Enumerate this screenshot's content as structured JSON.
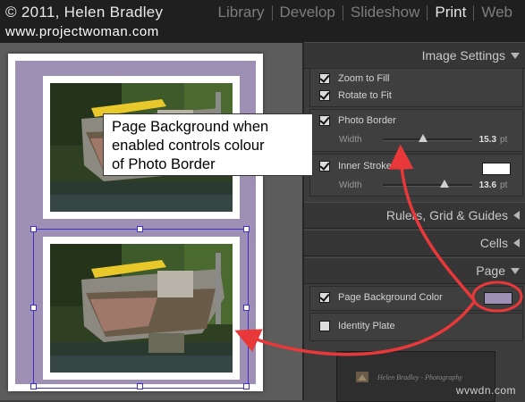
{
  "header": {
    "copyright": "© 2011, Helen Bradley",
    "website": "www.projectwoman.com",
    "modules": [
      "Library",
      "Develop",
      "Slideshow",
      "Print",
      "Web"
    ],
    "active_module": "Print"
  },
  "callout": {
    "text": "Page Background when\nenabled controls colour\nof Photo Border"
  },
  "panel": {
    "image_settings": {
      "title": "Image Settings",
      "zoom_to_fill": "Zoom to Fill",
      "rotate_to_fit": "Rotate to Fit",
      "photo_border": "Photo Border",
      "photo_border_width_label": "Width",
      "photo_border_width": "15.3",
      "photo_border_unit": "pt",
      "photo_border_level": 0.45,
      "inner_stroke": "Inner Stroke",
      "inner_stroke_width_label": "Width",
      "inner_stroke_width": "13.6",
      "inner_stroke_unit": "pt",
      "inner_stroke_level": 0.69,
      "inner_stroke_color": "#ffffff"
    },
    "rulers_title": "Rulers, Grid & Guides",
    "cells_title": "Cells",
    "page": {
      "title": "Page",
      "page_bg_label": "Page Background Color",
      "page_bg_color": "#9d90b4",
      "identity_plate_label": "Identity Plate",
      "identity_plate_text": "Helen Bradley - Photography"
    }
  },
  "watermark": "wvwdn.com",
  "colors": {
    "annotation_red": "#e8383a",
    "selection_blue": "#4030c8",
    "page_background": "#9d90b4"
  }
}
